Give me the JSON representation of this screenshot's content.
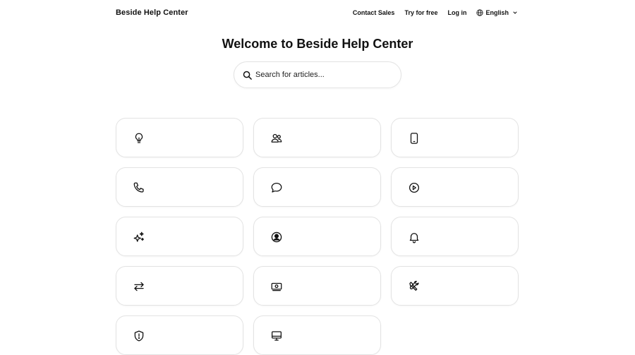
{
  "header": {
    "brand": "Beside Help Center",
    "nav": {
      "contact_sales": "Contact Sales",
      "try_free": "Try for free",
      "log_in": "Log in",
      "language": "English"
    }
  },
  "main": {
    "title": "Welcome to Beside Help Center",
    "search": {
      "placeholder": "Search for articles...",
      "value": ""
    }
  },
  "categories": [
    {
      "icon": "lightbulb-icon"
    },
    {
      "icon": "users-icon"
    },
    {
      "icon": "phone-device-icon"
    },
    {
      "icon": "phone-call-icon"
    },
    {
      "icon": "chat-bubble-icon"
    },
    {
      "icon": "play-circle-icon"
    },
    {
      "icon": "sparkles-icon"
    },
    {
      "icon": "user-circle-icon"
    },
    {
      "icon": "bell-icon"
    },
    {
      "icon": "arrows-exchange-icon"
    },
    {
      "icon": "money-icon"
    },
    {
      "icon": "tools-icon"
    },
    {
      "icon": "shield-icon"
    },
    {
      "icon": "computer-icon"
    }
  ]
}
